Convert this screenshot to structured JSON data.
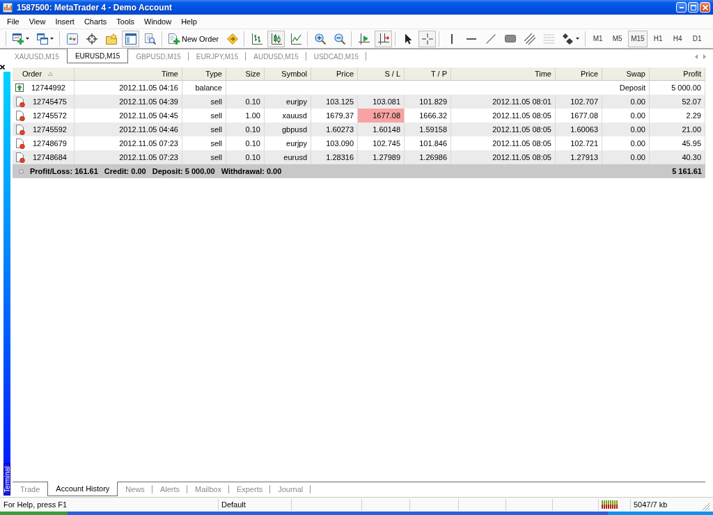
{
  "window": {
    "title": "1587500: MetaTrader 4 - Demo Account"
  },
  "menu": [
    "File",
    "View",
    "Insert",
    "Charts",
    "Tools",
    "Window",
    "Help"
  ],
  "toolbar": {
    "groups": [
      [
        {
          "kind": "newchart",
          "pressed": false
        },
        {
          "kind": "profiles",
          "pressed": false
        }
      ],
      [
        {
          "kind": "marketwatch",
          "pressed": false
        },
        {
          "kind": "datawindow",
          "pressed": false
        },
        {
          "kind": "navigator",
          "pressed": false
        },
        {
          "kind": "terminal",
          "pressed": true
        },
        {
          "kind": "tester",
          "pressed": false
        }
      ],
      [
        {
          "kind": "neworder",
          "label": "New Order",
          "pressed": false
        },
        {
          "kind": "autotrading",
          "pressed": false
        }
      ],
      [
        {
          "kind": "bars",
          "pressed": false
        },
        {
          "kind": "candles",
          "pressed": true
        },
        {
          "kind": "line",
          "pressed": false
        }
      ],
      [
        {
          "kind": "zoomin",
          "pressed": false
        },
        {
          "kind": "zoomout",
          "pressed": false
        }
      ],
      [
        {
          "kind": "shift",
          "pressed": false
        },
        {
          "kind": "autoscroll",
          "pressed": true
        }
      ],
      [
        {
          "kind": "cursor",
          "pressed": false
        },
        {
          "kind": "crosshair",
          "pressed": true
        }
      ],
      [
        {
          "kind": "vline",
          "pressed": false
        },
        {
          "kind": "hline",
          "pressed": false
        },
        {
          "kind": "trendline",
          "pressed": false
        },
        {
          "kind": "rectangle",
          "pressed": false
        },
        {
          "kind": "channel",
          "pressed": false
        },
        {
          "kind": "fibonacci",
          "pressed": false
        },
        {
          "kind": "shapes",
          "pressed": false
        }
      ]
    ],
    "timeframes": [
      {
        "label": "M1",
        "selected": false
      },
      {
        "label": "M5",
        "selected": false
      },
      {
        "label": "M15",
        "selected": true
      },
      {
        "label": "H1",
        "selected": false
      },
      {
        "label": "H4",
        "selected": false
      },
      {
        "label": "D1",
        "selected": false
      }
    ]
  },
  "chart_tabs": [
    {
      "label": "XAUUSD,M15",
      "selected": false
    },
    {
      "label": "EURUSD,M15",
      "selected": true
    },
    {
      "label": "GBPUSD,M15",
      "selected": false
    },
    {
      "label": "EURJPY,M15",
      "selected": false
    },
    {
      "label": "AUDUSD,M15",
      "selected": false
    },
    {
      "label": "USDCAD,M15",
      "selected": false
    }
  ],
  "terminal": {
    "label": "Terminal",
    "table": {
      "columns": [
        {
          "label": "Order",
          "sorted": true
        },
        {
          "label": "Time",
          "sorted": false
        },
        {
          "label": "Type",
          "sorted": false
        },
        {
          "label": "Size",
          "sorted": false
        },
        {
          "label": "Symbol",
          "sorted": false
        },
        {
          "label": "Price",
          "sorted": false
        },
        {
          "label": "S / L",
          "sorted": false
        },
        {
          "label": "T / P",
          "sorted": false
        },
        {
          "label": "Time",
          "sorted": false
        },
        {
          "label": "Price",
          "sorted": false
        },
        {
          "label": "Swap",
          "sorted": false
        },
        {
          "label": "Profit",
          "sorted": false
        }
      ],
      "rows": [
        {
          "kind": "balance",
          "order": "12744992",
          "time": "2012.11.05 04:16",
          "type": "balance",
          "comment": "Deposit",
          "profit": "5 000.00"
        },
        {
          "kind": "trade",
          "order": "12745475",
          "time": "2012.11.05 04:39",
          "type": "sell",
          "size": "0.10",
          "symbol": "eurjpy",
          "price": "103.125",
          "sl": "103.081",
          "tp": "101.829",
          "close_time": "2012.11.05 08:01",
          "close_price": "102.707",
          "swap": "0.00",
          "profit": "52.07",
          "sl_hit": false
        },
        {
          "kind": "trade",
          "order": "12745572",
          "time": "2012.11.05 04:45",
          "type": "sell",
          "size": "1.00",
          "symbol": "xauusd",
          "price": "1679.37",
          "sl": "1677.08",
          "tp": "1666.32",
          "close_time": "2012.11.05 08:05",
          "close_price": "1677.08",
          "swap": "0.00",
          "profit": "2.29",
          "sl_hit": true
        },
        {
          "kind": "trade",
          "order": "12745592",
          "time": "2012.11.05 04:46",
          "type": "sell",
          "size": "0.10",
          "symbol": "gbpusd",
          "price": "1.60273",
          "sl": "1.60148",
          "tp": "1.59158",
          "close_time": "2012.11.05 08:05",
          "close_price": "1.60063",
          "swap": "0.00",
          "profit": "21.00",
          "sl_hit": false
        },
        {
          "kind": "trade",
          "order": "12748679",
          "time": "2012.11.05 07:23",
          "type": "sell",
          "size": "0.10",
          "symbol": "eurjpy",
          "price": "103.090",
          "sl": "102.745",
          "tp": "101.846",
          "close_time": "2012.11.05 08:05",
          "close_price": "102.721",
          "swap": "0.00",
          "profit": "45.95",
          "sl_hit": false
        },
        {
          "kind": "trade",
          "order": "12748684",
          "time": "2012.11.05 07:23",
          "type": "sell",
          "size": "0.10",
          "symbol": "eurusd",
          "price": "1.28316",
          "sl": "1.27989",
          "tp": "1.26986",
          "close_time": "2012.11.05 08:05",
          "close_price": "1.27913",
          "swap": "0.00",
          "profit": "40.30",
          "sl_hit": false
        }
      ],
      "summary": {
        "items": [
          "Profit/Loss: 161.61",
          "Credit: 0.00",
          "Deposit: 5 000.00",
          "Withdrawal: 0.00"
        ],
        "total": "5 161.61"
      }
    },
    "tabs": [
      {
        "label": "Trade",
        "selected": false
      },
      {
        "label": "Account History",
        "selected": true
      },
      {
        "label": "News",
        "selected": false
      },
      {
        "label": "Alerts",
        "selected": false
      },
      {
        "label": "Mailbox",
        "selected": false
      },
      {
        "label": "Experts",
        "selected": false
      },
      {
        "label": "Journal",
        "selected": false
      }
    ]
  },
  "status_bar": {
    "help": "For Help, press F1",
    "profile": "Default",
    "traffic": "5047/7 kb"
  }
}
